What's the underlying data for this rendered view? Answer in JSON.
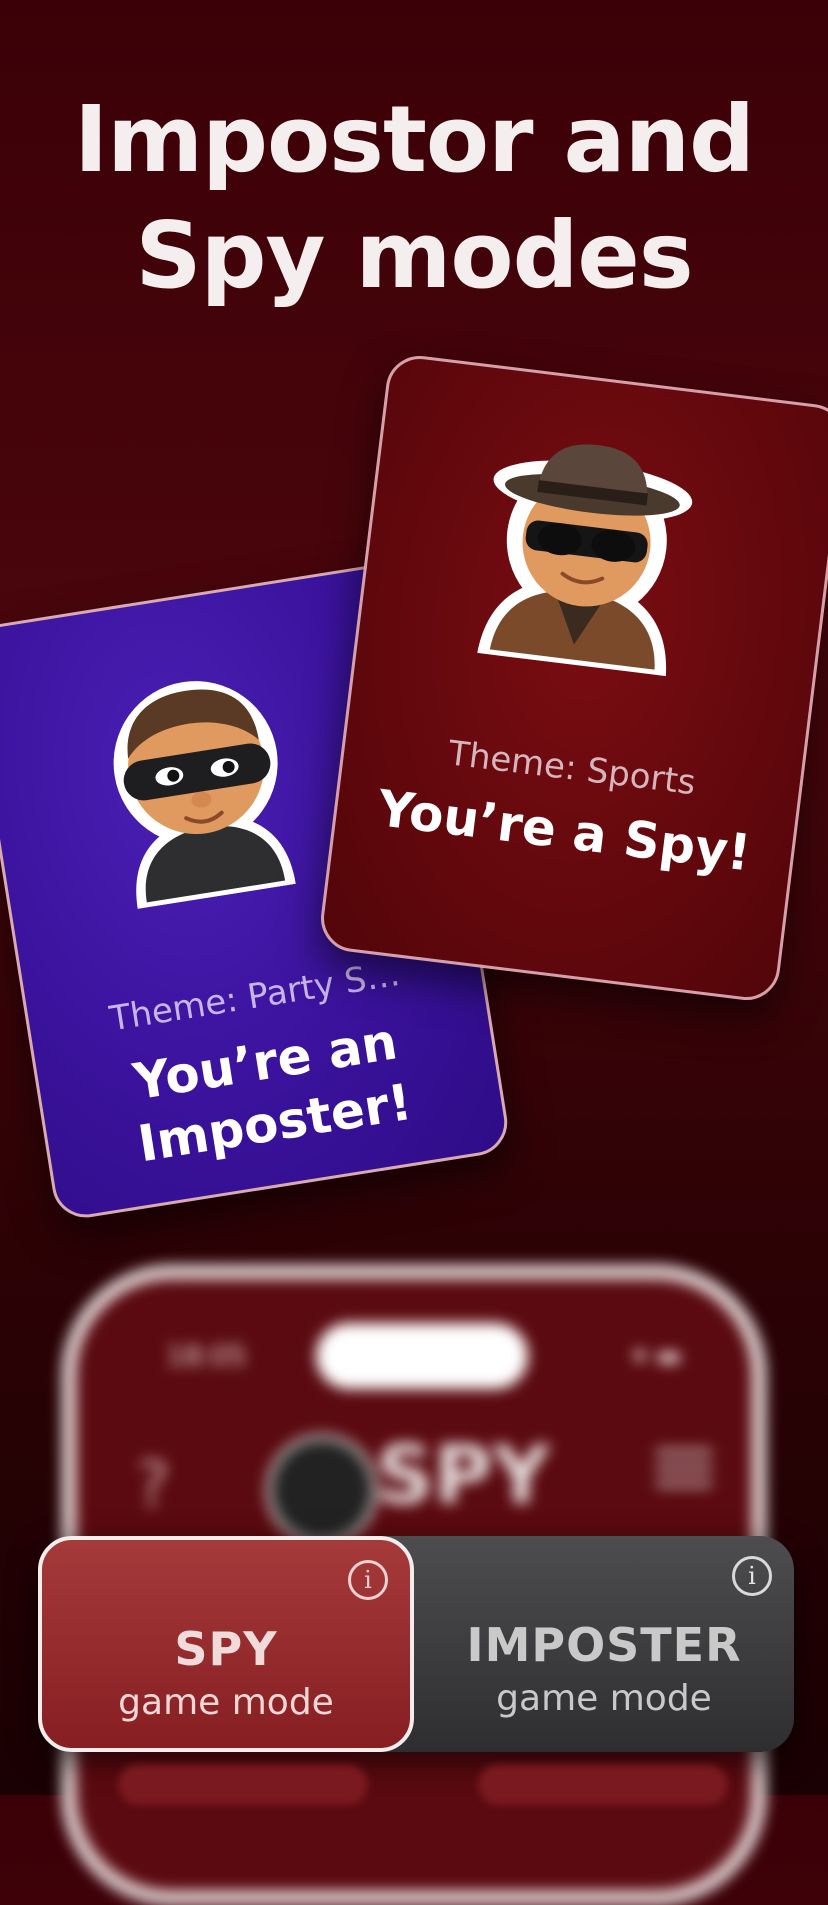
{
  "headline": {
    "line1": "Impostor and",
    "line2": "Spy modes"
  },
  "cards": {
    "imposter": {
      "theme": "Theme: Party S…",
      "role_line1": "You’re an",
      "role_line2": "Imposter!"
    },
    "spy": {
      "theme": "Theme: Sports",
      "role": "You’re a Spy!"
    }
  },
  "phone": {
    "time": "18:05",
    "brand": "SPY",
    "help": "?"
  },
  "mode_switch": {
    "spy": {
      "name": "SPY",
      "sub": "game mode"
    },
    "imposter": {
      "name": "IMPOSTER",
      "sub": "game mode"
    },
    "info": "i"
  },
  "colors": {
    "background": "#3b0007",
    "imposter_card": "#3a129c",
    "spy_card": "#62080d",
    "spy_mode": "#861e22",
    "imposter_mode": "#3a3a3c"
  }
}
